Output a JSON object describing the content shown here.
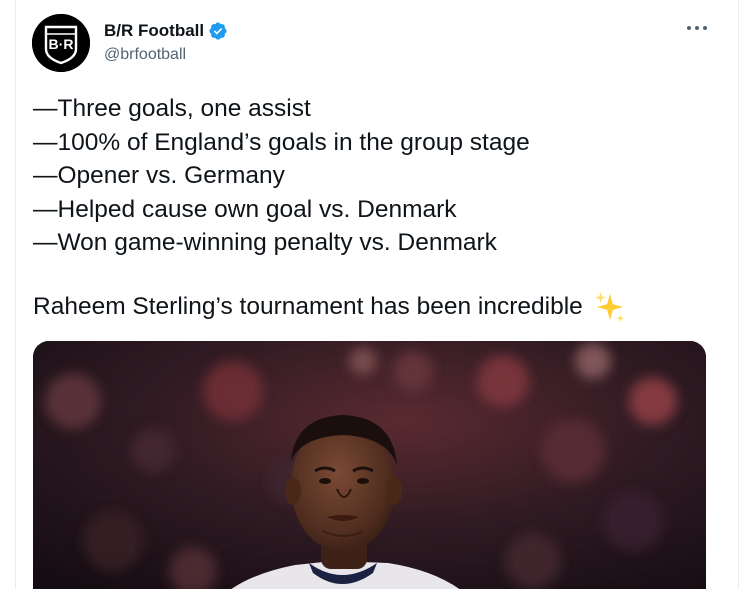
{
  "account": {
    "display_name": "B/R Football",
    "handle": "@brfootball",
    "avatar_text": "B·R",
    "verified": true
  },
  "tweet": {
    "lines": [
      "—Three goals, one assist",
      "—100% of England’s goals in the group stage",
      "—Opener vs. Germany",
      "—Helped cause own goal vs. Denmark",
      "—Won game-winning penalty vs. Denmark"
    ],
    "closing": "Raheem Sterling’s tournament has been incredible",
    "emoji_name": "sparkles-icon"
  },
  "icons": {
    "more": "more-options-icon",
    "verified": "verified-badge-icon"
  },
  "colors": {
    "verified_blue": "#1d9bf0",
    "text": "#0f1419",
    "secondary_text": "#536471",
    "sparkle_yellow": "#ffcc33"
  }
}
